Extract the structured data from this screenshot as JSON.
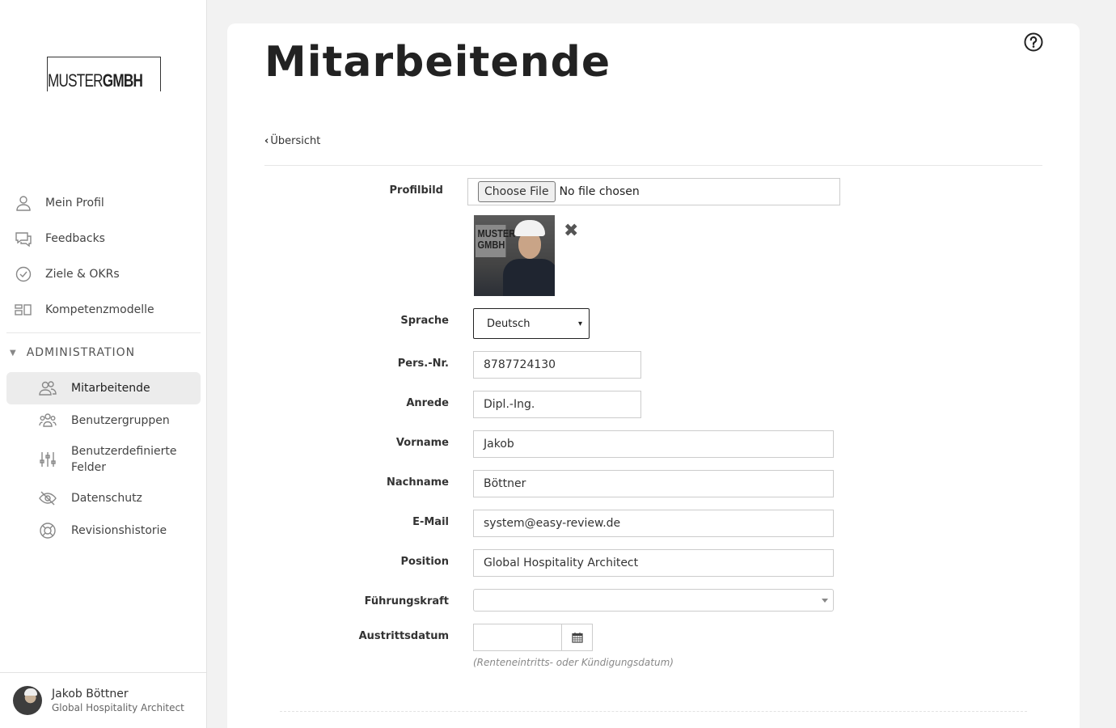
{
  "brand": {
    "logo_light": "MUSTER",
    "logo_bold": "GMBH"
  },
  "sidebar": {
    "items": [
      {
        "label": "Mein Profil",
        "icon": "user-icon"
      },
      {
        "label": "Feedbacks",
        "icon": "chat-icon"
      },
      {
        "label": "Ziele & OKRs",
        "icon": "check-circle-icon"
      },
      {
        "label": "Kompetenzmodelle",
        "icon": "layout-icon"
      }
    ],
    "section": "ADMINISTRATION",
    "sub_items": [
      {
        "label": "Mitarbeitende",
        "icon": "users-icon",
        "active": true
      },
      {
        "label": "Benutzergruppen",
        "icon": "user-group-icon"
      },
      {
        "label": "Benutzerdefinierte Felder",
        "icon": "sliders-icon"
      },
      {
        "label": "Datenschutz",
        "icon": "eye-off-icon"
      },
      {
        "label": "Revisionshistorie",
        "icon": "lifebuoy-icon"
      }
    ],
    "user": {
      "name": "Jakob Böttner",
      "role": "Global Hospitality Architect"
    }
  },
  "page": {
    "title": "Mitarbeitende",
    "back_label": "Übersicht"
  },
  "form": {
    "profilbild": {
      "label": "Profilbild",
      "button": "Choose File",
      "status": "No file chosen",
      "photo_sign": "MUSTER GMBH"
    },
    "sprache": {
      "label": "Sprache",
      "value": "Deutsch"
    },
    "persnr": {
      "label": "Pers.-Nr.",
      "value": "8787724130"
    },
    "anrede": {
      "label": "Anrede",
      "value": "Dipl.-Ing."
    },
    "vorname": {
      "label": "Vorname",
      "value": "Jakob"
    },
    "nachname": {
      "label": "Nachname",
      "value": "Böttner"
    },
    "email": {
      "label": "E-Mail",
      "value": "system@easy-review.de"
    },
    "position": {
      "label": "Position",
      "value": "Global Hospitality Architect"
    },
    "fuehrungskraft": {
      "label": "Führungskraft",
      "value": ""
    },
    "austritt": {
      "label": "Austrittsdatum",
      "value": "",
      "hint": "(Renteneintritts- oder Kündigungsdatum)"
    }
  }
}
